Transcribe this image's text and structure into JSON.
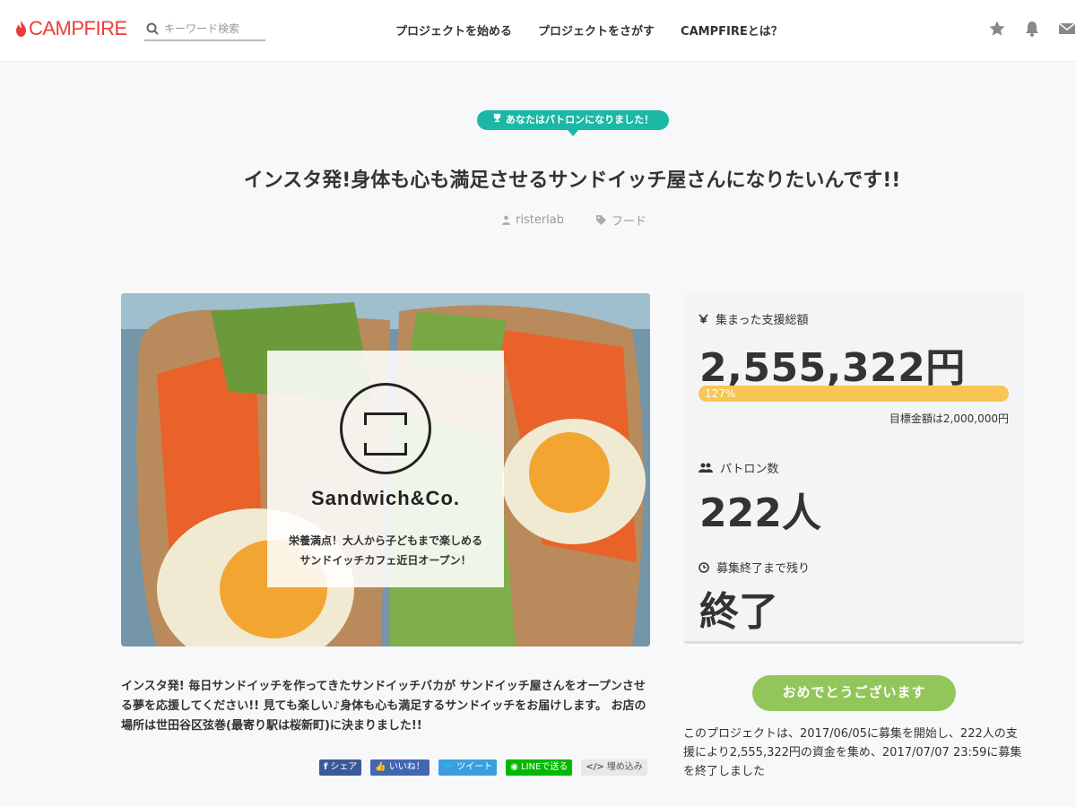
{
  "header": {
    "logo_text": "CAMPFIRE",
    "search_placeholder": "キーワード検索",
    "nav": [
      "プロジェクトを始める",
      "プロジェクトをさがす",
      "CAMPFIREとは？"
    ],
    "icons": [
      "star-icon",
      "bell-icon",
      "mail-icon"
    ]
  },
  "badge": {
    "text": "あなたはパトロンになりました！",
    "icon": "trophy-icon"
  },
  "project": {
    "title": "インスタ発!身体も心も満足させるサンドイッチ屋さんになりたいんです!!",
    "owner": "risterlab",
    "category": "フード"
  },
  "hero": {
    "brand": "Sandwich&Co.",
    "tagline1": "栄養満点！大人から子どもまで楽しめる",
    "tagline2": "サンドイッチカフェ近日オープン！"
  },
  "stats": {
    "amount_label": "集まった支援総額",
    "amount": "2,555,322円",
    "percent": "127%",
    "percent_value": 127,
    "goal": "目標金額は2,000,000円",
    "patrons_label": "パトロン数",
    "patrons": "222人",
    "remaining_label": "募集終了まで残り",
    "remaining": "終了"
  },
  "congrats_button": "おめでとうございます",
  "summary": "このプロジェクトは、2017/06/05に募集を開始し、222人の支援により2,555,322円の資金を集め、2017/07/07 23:59に募集を終了しました",
  "description": "インスタ発! 毎日サンドイッチを作ってきたサンドイッチバカが サンドイッチ屋さんをオープンさせる夢を応援してください!! 見ても楽しい♪身体も心も満足するサンドイッチをお届けします。 お店の場所は世田谷区弦巻(最寄り駅は桜新町)に決まりました!!",
  "share": {
    "facebook": "シェア",
    "like": "いいね！",
    "tweet": "ツイート",
    "line": "LINEで送る",
    "embed": "埋め込み"
  },
  "colors": {
    "brand": "#ec3c3c",
    "badge": "#1ab8a5",
    "progress": "#f9c653",
    "congrats": "#93c65a"
  }
}
